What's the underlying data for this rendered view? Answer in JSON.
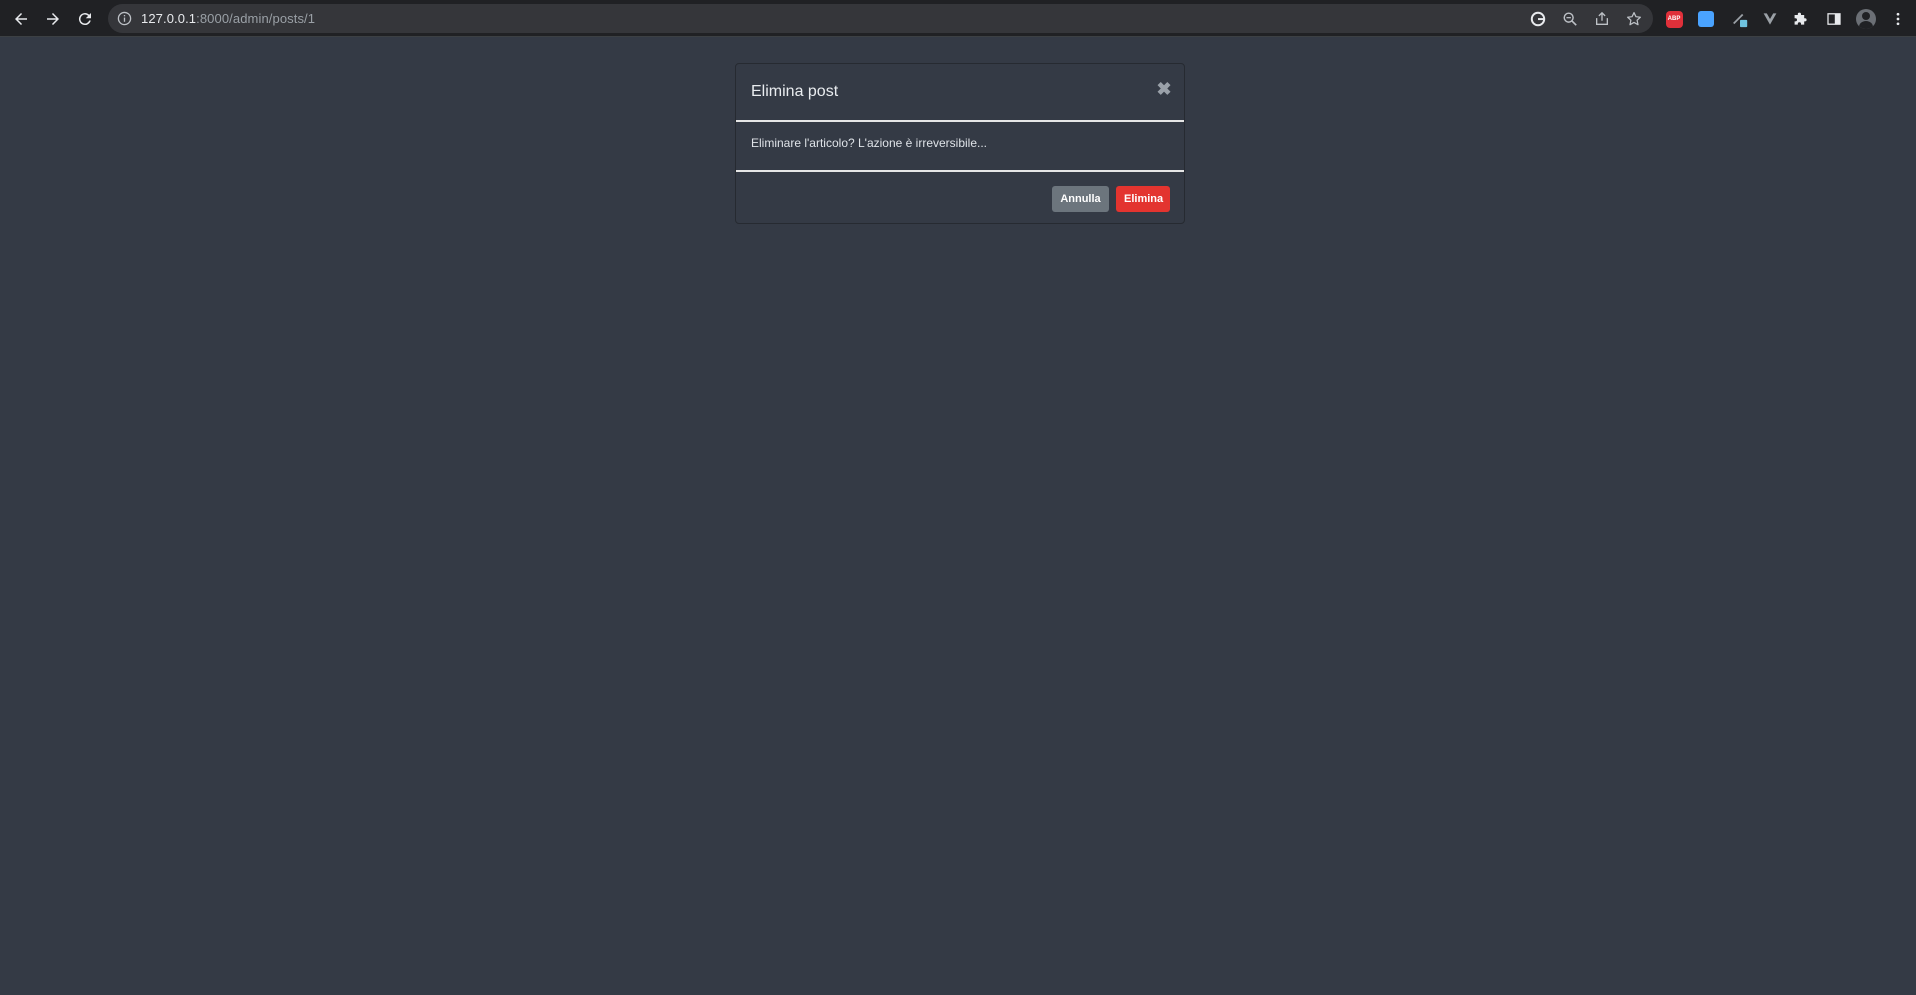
{
  "browser": {
    "url_host": "127.0.0.1",
    "url_path": ":8000/admin/posts/1",
    "extensions": [
      "abp-icon",
      "cloud-extension-icon",
      "pen-extension-icon",
      "vuejs-devtools-icon",
      "puzzle-extensions-icon",
      "side-panel-icon",
      "profile-avatar",
      "more-menu-icon"
    ],
    "abp_label": "ABP"
  },
  "modal": {
    "title": "Elimina post",
    "close_glyph": "✖",
    "body": "Eliminare l'articolo? L'azione è irreversibile...",
    "cancel_label": "Annulla",
    "delete_label": "Elimina"
  },
  "colors": {
    "page_bg": "#343a45",
    "toolbar_bg": "#202124",
    "danger": "#e3342f",
    "secondary": "#6c757d"
  }
}
